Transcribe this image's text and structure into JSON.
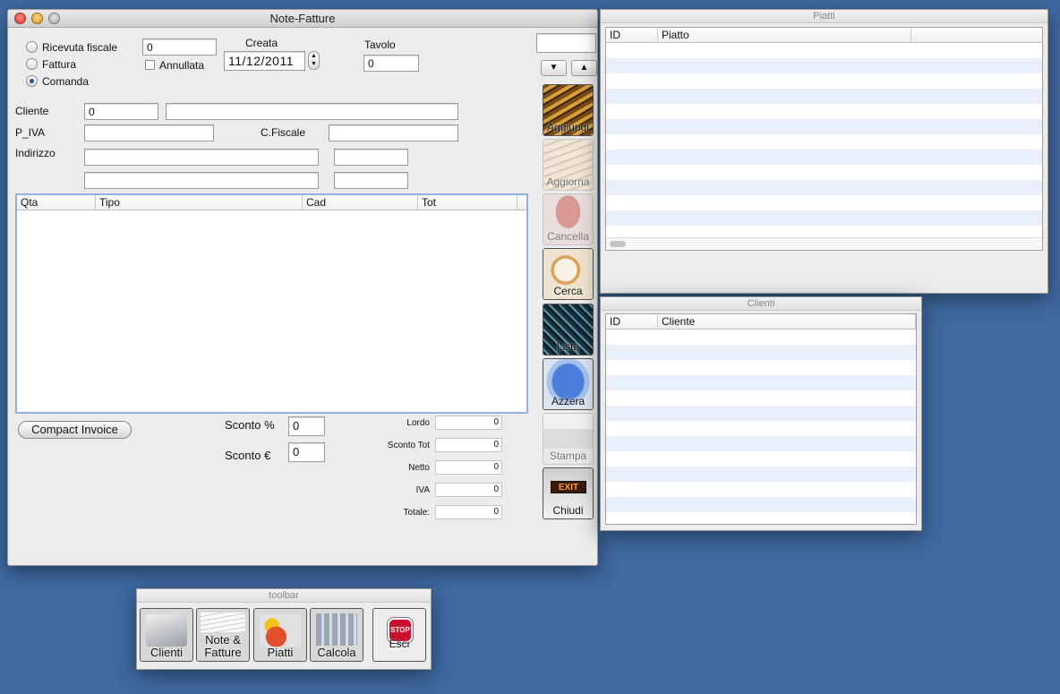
{
  "note_window": {
    "title": "Note-Fatture",
    "doc_types": [
      {
        "label": "Ricevuta fiscale",
        "selected": false
      },
      {
        "label": "Fattura",
        "selected": false
      },
      {
        "label": "Comanda",
        "selected": true
      }
    ],
    "number_value": "0",
    "annullata_label": "Annullata",
    "creata_label": "Creata",
    "creata_date": "11/12/2011",
    "tavolo_label": "Tavolo",
    "tavolo_value": "0",
    "search_value": "",
    "cliente_label": "Cliente",
    "cliente_id_value": "0",
    "cliente_name_value": "",
    "piva_label": "P_IVA",
    "cfiscale_label": "C.Fiscale",
    "indirizzo_label": "Indirizzo",
    "table_headers": [
      "Qta",
      "Tipo",
      "Cad",
      "Tot"
    ],
    "compact_invoice_label": "Compact Invoice",
    "sconto_pct_label": "Sconto %",
    "sconto_pct_value": "0",
    "sconto_eur_label": "Sconto €",
    "sconto_eur_value": "0",
    "totals": [
      {
        "label": "Lordo",
        "value": "0"
      },
      {
        "label": "Sconto Tot",
        "value": "0"
      },
      {
        "label": "Netto",
        "value": "0"
      },
      {
        "label": "IVA",
        "value": "0"
      },
      {
        "label": "Totale:",
        "value": "0"
      }
    ],
    "side_buttons": [
      "Aggiungi",
      "Aggiorna",
      "Cancella",
      "Cerca",
      "Lista",
      "Azzera",
      "Stampa",
      "Chiudi"
    ],
    "exit_sign": "EXIT"
  },
  "piatti_window": {
    "title": "Piatti",
    "headers": [
      "ID",
      "Piatto"
    ]
  },
  "clienti_window": {
    "title": "Clienti",
    "headers": [
      "ID",
      "Cliente"
    ]
  },
  "toolbar_window": {
    "title": "toolbar",
    "buttons": [
      "Clienti",
      "Note &",
      "Fatture",
      "Piatti",
      "Calcola",
      "Esci"
    ],
    "stop_sign": "STOP"
  },
  "colors": {
    "desktop": "#3f6aa2",
    "selection_blue": "#1d4f9a",
    "stripe": "#e9f0fb"
  }
}
